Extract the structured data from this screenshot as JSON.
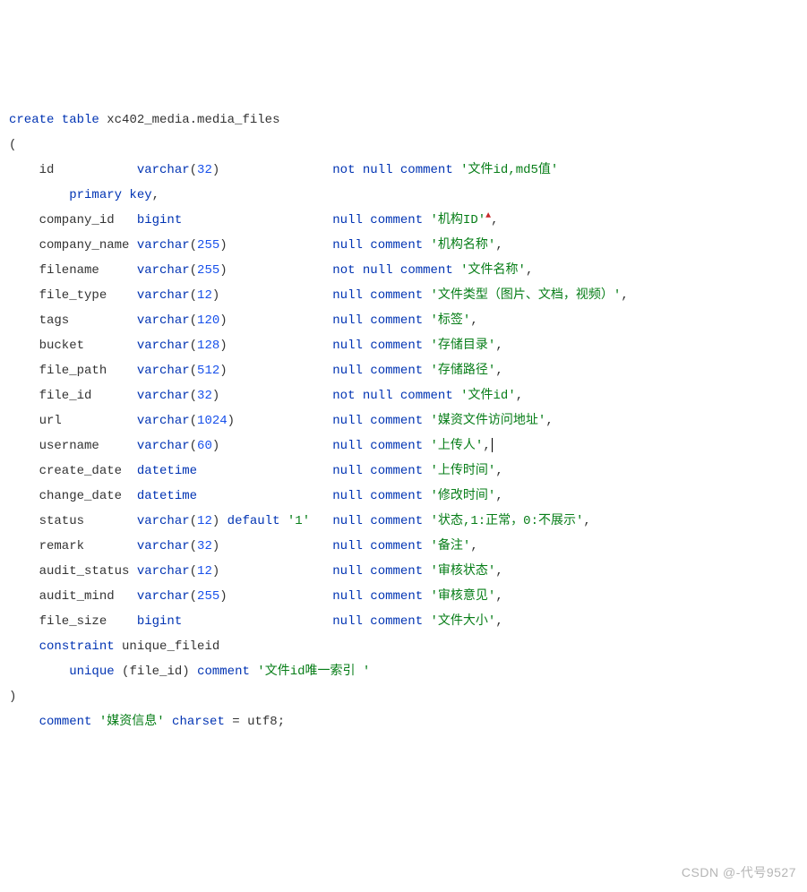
{
  "sql": {
    "create_kw": "create table",
    "table_name": "xc402_media.media_files",
    "open_paren": "(",
    "close_paren": ")",
    "primary_key_kw": "primary key",
    "constraint_kw": "constraint",
    "constraint_name": "unique_fileid",
    "unique_kw": "unique",
    "unique_col": "file_id",
    "comment_kw": "comment",
    "unique_comment": "'文件id唯一索引 '",
    "table_comment": "'媒资信息'",
    "charset_kw": "charset",
    "eq": "=",
    "charset_val": "utf8",
    "semicolon": ";"
  },
  "cols": [
    {
      "name": "id",
      "type": "varchar",
      "len": "32",
      "null": "not null",
      "comment": "'文件id,md5值'"
    },
    {
      "name": "company_id",
      "type": "bigint",
      "len": "",
      "null": "null",
      "comment": "'机构ID'",
      "caret": true,
      "comma": ","
    },
    {
      "name": "company_name",
      "type": "varchar",
      "len": "255",
      "null": "null",
      "comment": "'机构名称'",
      "comma": ","
    },
    {
      "name": "filename",
      "type": "varchar",
      "len": "255",
      "null": "not null",
      "comment": "'文件名称'",
      "comma": ","
    },
    {
      "name": "file_type",
      "type": "varchar",
      "len": "12",
      "null": "null",
      "comment": "'文件类型（图片、文档，视频）'",
      "comma": ","
    },
    {
      "name": "tags",
      "type": "varchar",
      "len": "120",
      "null": "null",
      "comment": "'标签'",
      "comma": ","
    },
    {
      "name": "bucket",
      "type": "varchar",
      "len": "128",
      "null": "null",
      "comment": "'存储目录'",
      "comma": ","
    },
    {
      "name": "file_path",
      "type": "varchar",
      "len": "512",
      "null": "null",
      "comment": "'存储路径'",
      "comma": ","
    },
    {
      "name": "file_id",
      "type": "varchar",
      "len": "32",
      "null": "not null",
      "comment": "'文件id'",
      "comma": ","
    },
    {
      "name": "url",
      "type": "varchar",
      "len": "1024",
      "null": "null",
      "comment": "'媒资文件访问地址'",
      "comma": ","
    },
    {
      "name": "username",
      "type": "varchar",
      "len": "60",
      "null": "null",
      "comment": "'上传人'",
      "comma": ",",
      "cursor": true
    },
    {
      "name": "create_date",
      "type": "datetime",
      "len": "",
      "null": "null",
      "comment": "'上传时间'",
      "comma": ","
    },
    {
      "name": "change_date",
      "type": "datetime",
      "len": "",
      "null": "null",
      "comment": "'修改时间'",
      "comma": ","
    },
    {
      "name": "status",
      "type": "varchar",
      "len": "12",
      "default": "'1'",
      "null": "null",
      "comment": "'状态,1:正常，0:不展示'",
      "comma": ","
    },
    {
      "name": "remark",
      "type": "varchar",
      "len": "32",
      "null": "null",
      "comment": "'备注'",
      "comma": ","
    },
    {
      "name": "audit_status",
      "type": "varchar",
      "len": "12",
      "null": "null",
      "comment": "'审核状态'",
      "comma": ","
    },
    {
      "name": "audit_mind",
      "type": "varchar",
      "len": "255",
      "null": "null",
      "comment": "'审核意见'",
      "comma": ","
    },
    {
      "name": "file_size",
      "type": "bigint",
      "len": "",
      "null": "null",
      "comment": "'文件大小'",
      "comma": ","
    }
  ],
  "watermark": "CSDN @-代号9527"
}
